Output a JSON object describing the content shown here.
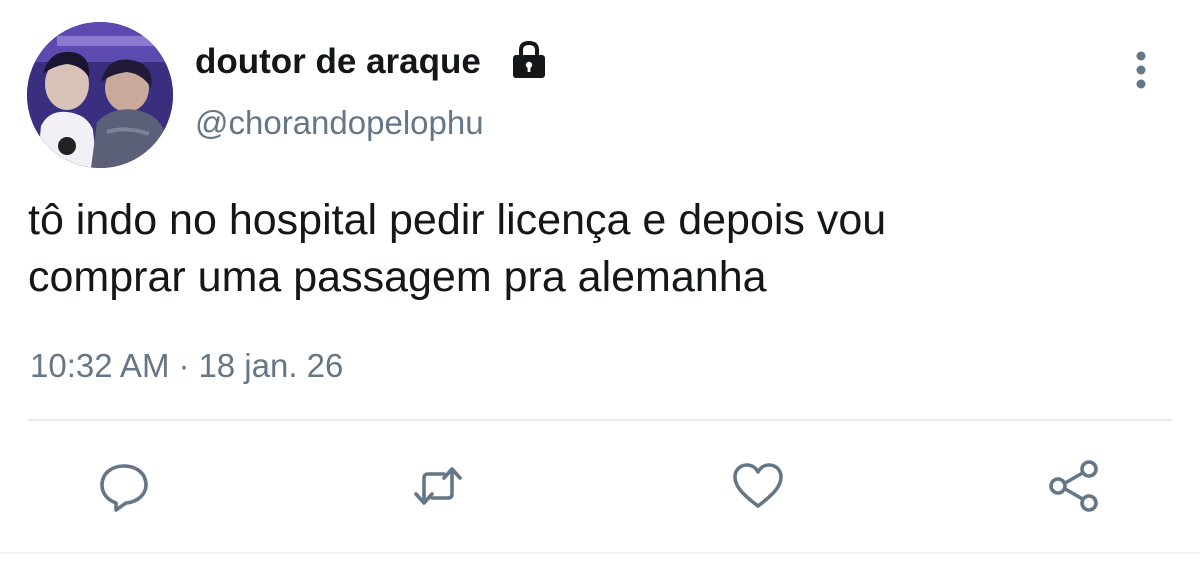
{
  "user": {
    "display_name": "doutor de araque",
    "handle": "@chorandopelophu",
    "protected_icon": "lock-icon",
    "avatar": "avatar-photo"
  },
  "tweet": {
    "text_lines": [
      "tô indo no hospital pedir licença e depois vou",
      "comprar uma passagem pra alemanha"
    ],
    "time": "10:32 AM",
    "separator": "·",
    "date": "18 jan. 26"
  },
  "actions": {
    "reply_icon": "reply-icon",
    "retweet_icon": "retweet-icon",
    "like_icon": "heart-icon",
    "share_icon": "share-icon",
    "more_icon": "more-options-icon"
  },
  "colors": {
    "text": "#14171a",
    "secondary": "#657786",
    "divider": "#e6ecf0"
  }
}
